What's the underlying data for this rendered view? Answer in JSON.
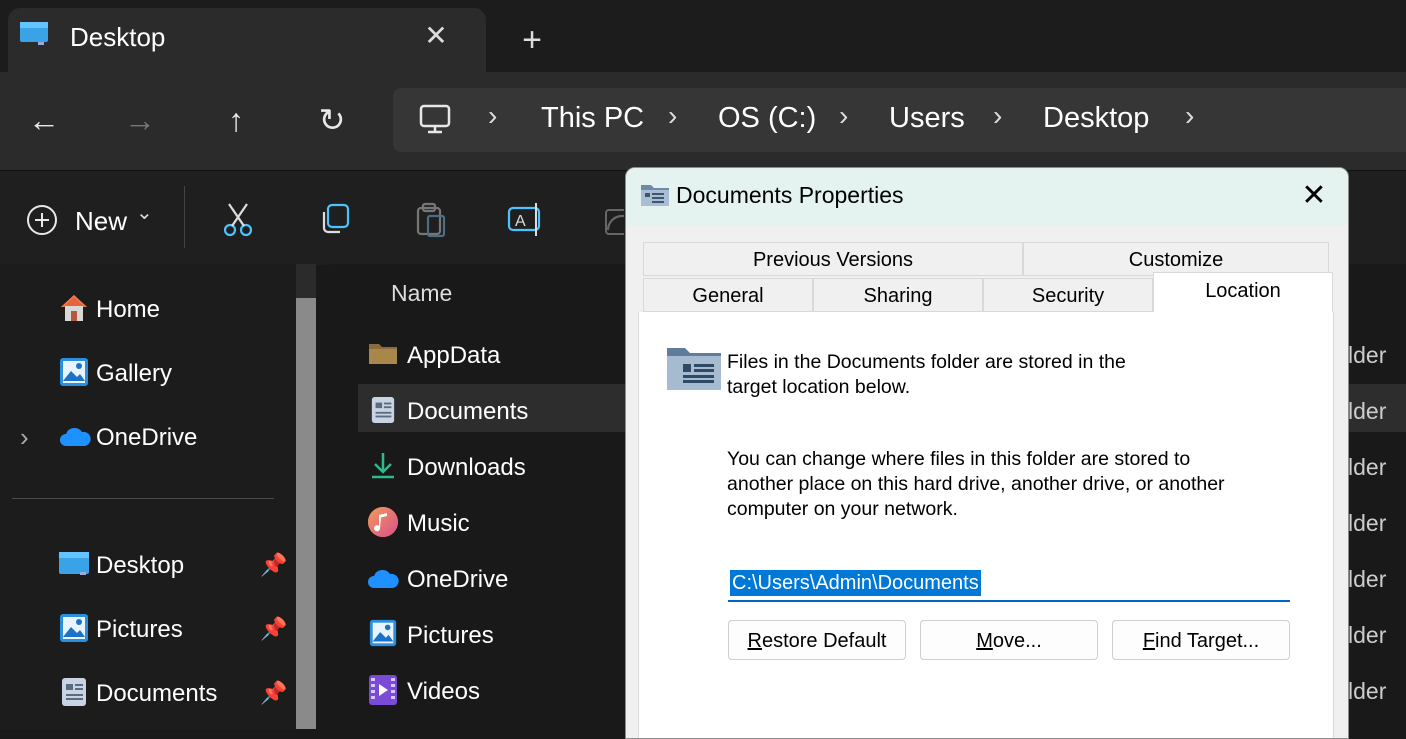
{
  "window": {
    "tab_title": "Desktop",
    "close_glyph": "✕",
    "new_tab_glyph": "+"
  },
  "nav": {
    "back": "←",
    "forward": "→",
    "up": "↑",
    "refresh": "↻",
    "breadcrumb": [
      "This PC",
      "OS (C:)",
      "Users",
      "Desktop"
    ],
    "chevron": "›"
  },
  "commandbar": {
    "new_label": "New",
    "new_caret": "⌄"
  },
  "sidebar": {
    "items": [
      {
        "label": "Home",
        "icon": "home-icon"
      },
      {
        "label": "Gallery",
        "icon": "gallery-icon"
      },
      {
        "label": "OneDrive",
        "icon": "onedrive-icon"
      }
    ],
    "expand_glyph": "›",
    "quick_access": [
      {
        "label": "Desktop",
        "icon": "desktop-folder-icon"
      },
      {
        "label": "Pictures",
        "icon": "pictures-folder-icon"
      },
      {
        "label": "Documents",
        "icon": "documents-folder-icon"
      }
    ],
    "pin_glyph": "📌"
  },
  "files": {
    "column_name": "Name",
    "rows": [
      {
        "name": "AppData",
        "type": "lder"
      },
      {
        "name": "Documents",
        "type": "lder"
      },
      {
        "name": "Downloads",
        "type": "lder"
      },
      {
        "name": "Music",
        "type": "lder"
      },
      {
        "name": "OneDrive",
        "type": "lder"
      },
      {
        "name": "Pictures",
        "type": "lder"
      },
      {
        "name": "Videos",
        "type": "lder"
      }
    ]
  },
  "dialog": {
    "title": "Documents Properties",
    "close_glyph": "✕",
    "tabs_top": [
      "Previous Versions",
      "Customize"
    ],
    "tabs_bottom": [
      "General",
      "Sharing",
      "Security",
      "Location"
    ],
    "info_line1": "Files in the Documents folder are stored in the",
    "info_line2": "target location below.",
    "change_line1": "You can change where files in this folder are stored to",
    "change_line2": "another place on this hard drive, another drive, or another",
    "change_line3": "computer on your network.",
    "path": "C:\\Users\\Admin\\Documents",
    "btn_restore_first": "R",
    "btn_restore_rest": "estore Default",
    "btn_move_first": "M",
    "btn_move_rest": "ove...",
    "btn_find_first": "F",
    "btn_find_rest": "ind Target..."
  }
}
